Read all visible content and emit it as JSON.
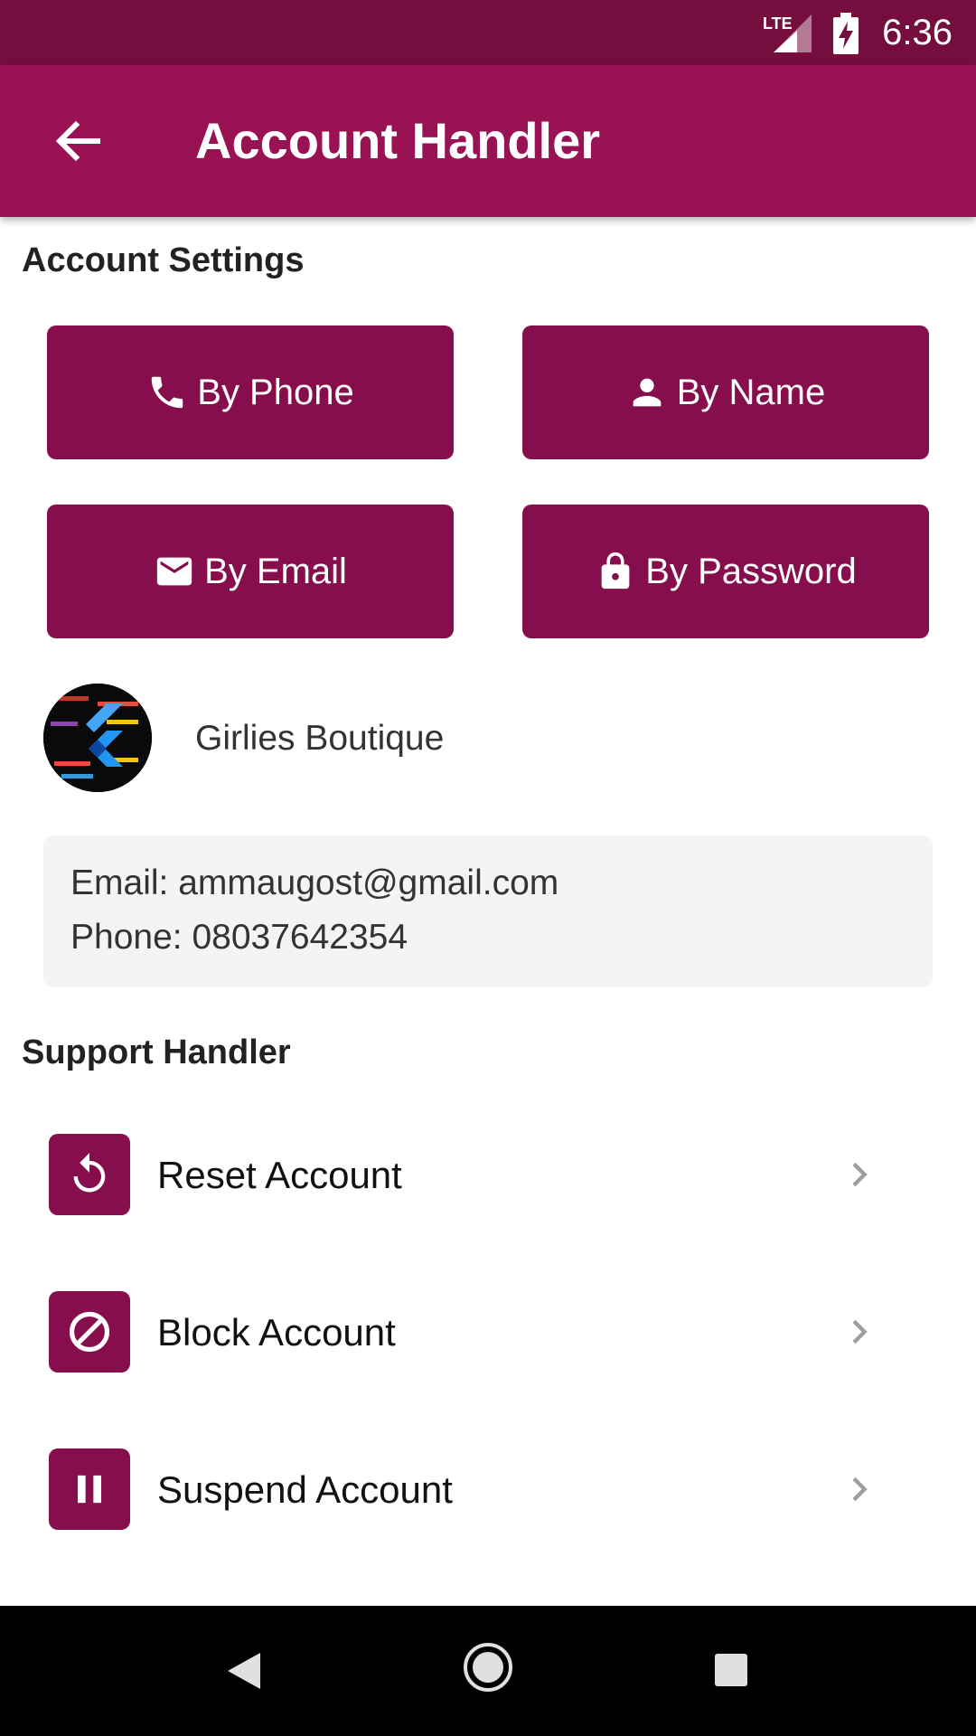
{
  "status_bar": {
    "time": "6:36",
    "network": "LTE"
  },
  "app_bar": {
    "title": "Account Handler"
  },
  "account_settings": {
    "title": "Account Settings",
    "buttons": [
      {
        "label": "By Phone",
        "icon": "phone-icon"
      },
      {
        "label": "By Name",
        "icon": "person-icon"
      },
      {
        "label": "By Email",
        "icon": "email-icon"
      },
      {
        "label": "By Password",
        "icon": "lock-icon"
      }
    ]
  },
  "profile": {
    "name": "Girlies Boutique",
    "email_line": "Email: ammaugost@gmail.com",
    "phone_line": "Phone: 08037642354"
  },
  "support_handler": {
    "title": "Support Handler",
    "items": [
      {
        "label": "Reset Account",
        "icon": "reset-icon"
      },
      {
        "label": "Block Account",
        "icon": "block-icon"
      },
      {
        "label": "Suspend Account",
        "icon": "pause-icon"
      }
    ]
  },
  "colors": {
    "status_bar": "#750e3f",
    "app_bar": "#981254",
    "accent": "#860e4c",
    "card": "#f4f4f4"
  }
}
